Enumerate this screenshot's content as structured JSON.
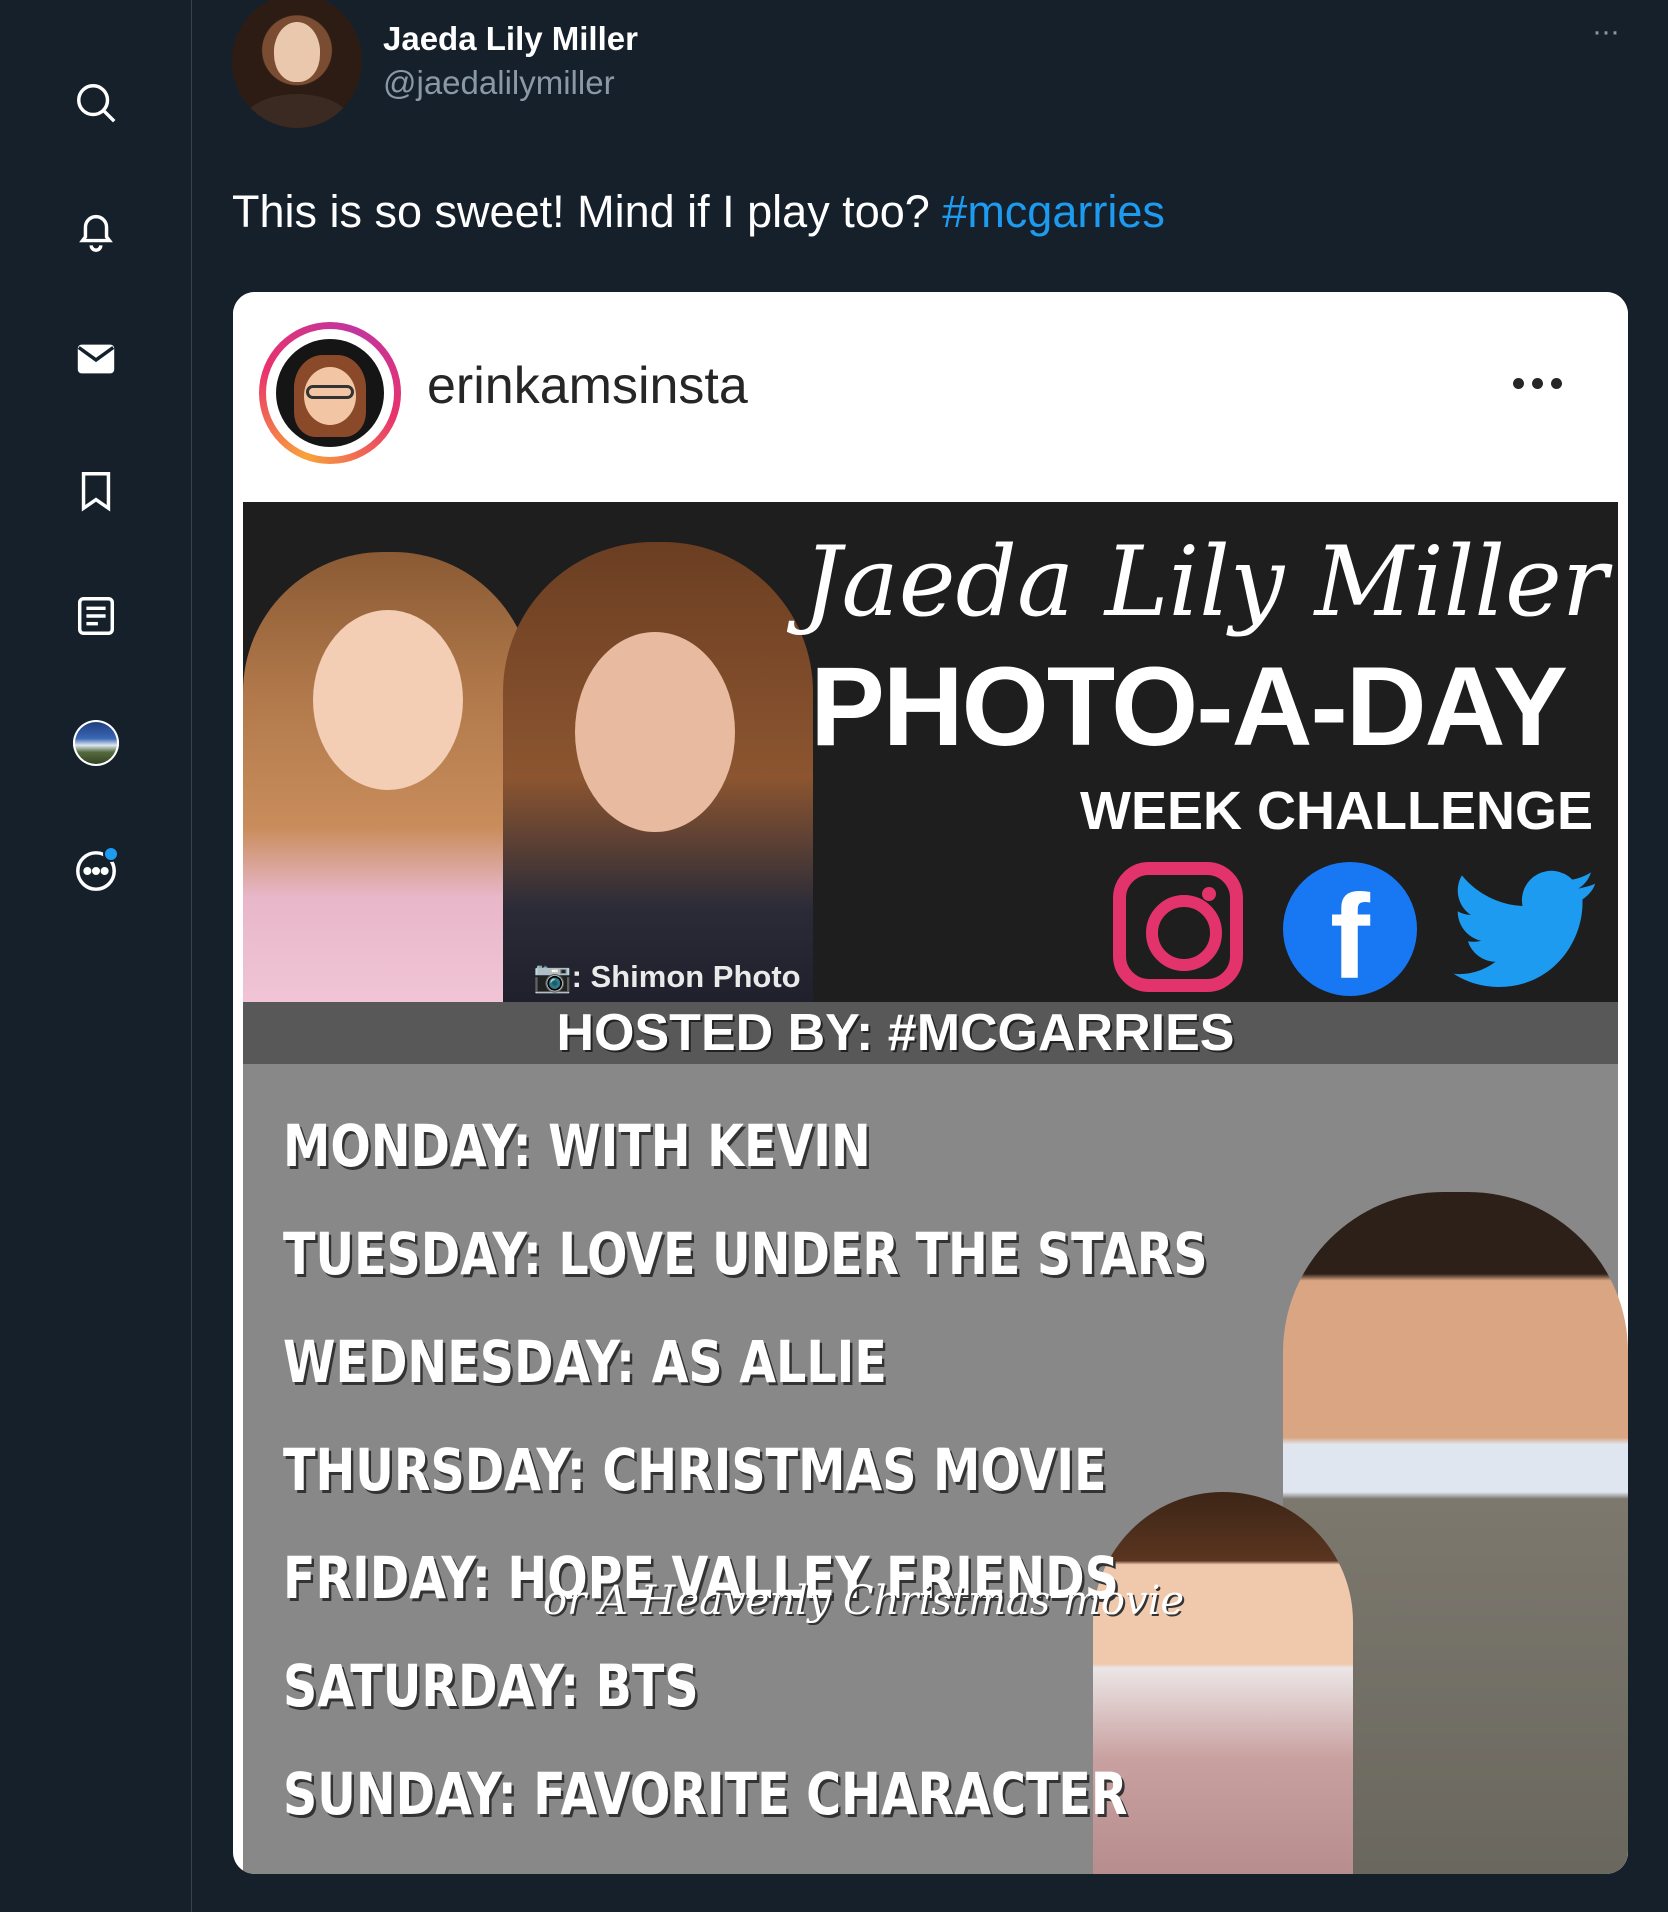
{
  "sidebar": {
    "icons": [
      "search-icon",
      "bell-icon",
      "mail-icon",
      "bookmark-icon",
      "lists-icon",
      "profile-avatar",
      "more-icon"
    ]
  },
  "tweet": {
    "author_name": "Jaeda Lily Miller",
    "author_handle": "@jaedalilymiller",
    "more": "···",
    "text": "This is so sweet! Mind if I play too? ",
    "hashtag": "#mcgarries"
  },
  "card": {
    "username": "erinkamsinsta",
    "banner": {
      "script_name": "Jaeda Lily Miller",
      "headline": "PHOTO-A-DAY",
      "subheadline": "WEEK CHALLENGE",
      "photo_credit": "📷: Shimon Photo",
      "hosted_by": "HOSTED BY: #MCGARRIES",
      "social_icons": [
        "instagram-icon",
        "facebook-icon",
        "twitter-icon"
      ],
      "facebook_glyph": "f",
      "days": [
        "MONDAY: WITH KEVIN",
        "TUESDAY: LOVE UNDER THE STARS",
        "WEDNESDAY: AS ALLIE",
        "THURSDAY: CHRISTMAS MOVIE",
        "FRIDAY: HOPE VALLEY FRIENDS",
        "SATURDAY: BTS",
        "SUNDAY: FAVORITE CHARACTER"
      ],
      "friday_note": "or A Heavenly Christmas movie"
    }
  },
  "colors": {
    "background": "#15202b",
    "accent": "#1d9bf0",
    "secondary_text": "#8b98a5"
  }
}
